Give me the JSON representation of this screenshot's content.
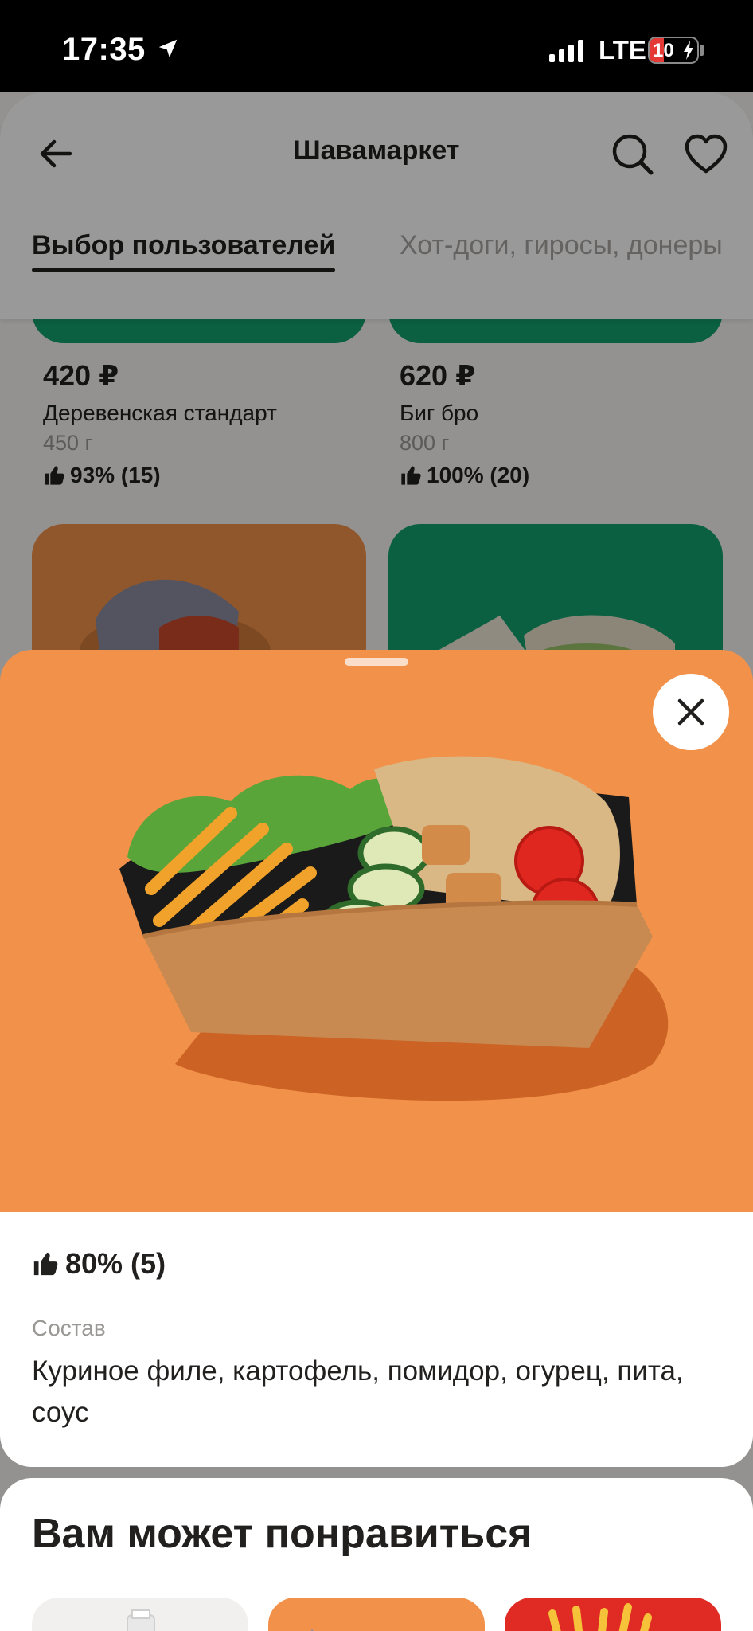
{
  "status_bar": {
    "time": "17:35",
    "network": "LTE",
    "battery": "10"
  },
  "header": {
    "title": "Шавамаркет",
    "back_icon": "arrow-left-icon",
    "search_icon": "search-icon",
    "favorite_icon": "heart-icon"
  },
  "tabs": [
    {
      "label": "Выбор пользователей",
      "active": true
    },
    {
      "label": "Хот-доги, гиросы, донеры",
      "active": false
    }
  ],
  "products": [
    {
      "price": "420 ₽",
      "name": "Деревенская стандарт",
      "weight": "450 г",
      "rating": "93% (15)"
    },
    {
      "price": "620 ₽",
      "name": "Биг бро",
      "weight": "800 г",
      "rating": "100% (20)"
    }
  ],
  "product_sheet": {
    "rating": "80% (5)",
    "composition_label": "Состав",
    "composition": "Куриное филе, картофель, помидор, огурец, пита, соус"
  },
  "recommendations": {
    "title": "Вам может понравиться"
  },
  "colors": {
    "brand_green": "#13a06e",
    "photo_orange": "#f2924a",
    "text_primary": "#21201f",
    "text_secondary": "#9a9895"
  }
}
